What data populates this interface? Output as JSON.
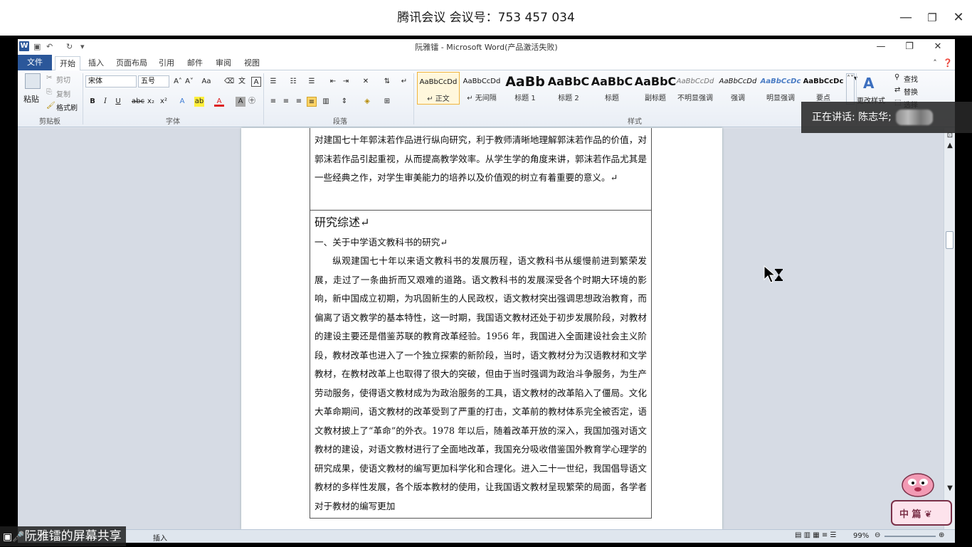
{
  "meeting": {
    "title": "腾讯会议 会议号：753 457 034",
    "minimize": "—",
    "restore": "❐",
    "close": "✕"
  },
  "word": {
    "window_title": "阮雅镭 - Microsoft Word(产品激活失败)",
    "tabs": [
      "文件",
      "开始",
      "插入",
      "页面布局",
      "引用",
      "邮件",
      "审阅",
      "视图"
    ],
    "clipboard": {
      "paste": "粘贴",
      "cut": "剪切",
      "copy": "复制",
      "format_painter": "格式刷",
      "label": "剪贴板"
    },
    "font": {
      "name": "宋体",
      "size": "五号",
      "label": "字体"
    },
    "paragraph": {
      "label": "段落"
    },
    "styles": {
      "label": "样式",
      "items": [
        {
          "preview": "AaBbCcDd",
          "name": "↵ 正文"
        },
        {
          "preview": "AaBbCcDd",
          "name": "↵ 无间隔"
        },
        {
          "preview": "AaBb",
          "name": "标题 1"
        },
        {
          "preview": "AaBbC",
          "name": "标题 2"
        },
        {
          "preview": "AaBbC",
          "name": "标题"
        },
        {
          "preview": "AaBbC",
          "name": "副标题"
        },
        {
          "preview": "AaBbCcDd",
          "name": "不明显强调"
        },
        {
          "preview": "AaBbCcDd",
          "name": "强调"
        },
        {
          "preview": "AaBbCcDc",
          "name": "明显强调"
        },
        {
          "preview": "AaBbCcDc",
          "name": "要点"
        }
      ],
      "change_styles": "更改样式"
    },
    "editing": {
      "find": "查找",
      "replace": "替换",
      "select": "选择"
    },
    "status": {
      "mode": "插入",
      "zoom": "99%"
    }
  },
  "document": {
    "cell1_text": "对建国七十年郭沫若作品进行纵向研究，利于教师清晰地理解郭沫若作品的价值，对郭沫若作品引起重视，从而提高教学效率。从学生学的角度来讲，郭沫若作品尤其是一些经典之作，对学生审美能力的培养以及价值观的树立有着重要的意义。↵",
    "heading": "研究综述↵",
    "subheading": "一、关于中学语文教科书的研究↵",
    "body": "纵观建国七十年以来语文教科书的发展历程，语文教科书从缓慢前进到繁荣发展，走过了一条曲折而又艰难的道路。语文教科书的发展深受各个时期大环境的影响，新中国成立初期，为巩固新生的人民政权，语文教材突出强调思想政治教育，而偏离了语文教学的基本特性，这一时期，我国语文教材还处于初步发展阶段，对教材的建设主要还是借鉴苏联的教育改革经验。1956 年，我国进入全面建设社会主义阶段，教材改革也进入了一个独立探索的新阶段，当时，语文教材分为汉语教材和文学教材，在教材改革上也取得了很大的突破，但由于当时强调为政治斗争服务，为生产劳动服务，使得语文教材成为为政治服务的工具，语文教材的改革陷入了僵局。文化大革命期间，语文教材的改革受到了严重的打击，文革前的教材体系完全被否定，语文教材披上了“革命”的外衣。1978 年以后，随着改革开放的深入，我国加强对语文教材的建设，对语文教材进行了全面地改革，我国充分吸收借鉴国外教育学心理学的研究成果，使语文教材的编写更加科学化和合理化。进入二十一世纪，我国倡导语文教材的多样性发展，各个版本教材的使用，让我国语文教材呈现繁荣的局面，各学者对于教材的编写更加"
  },
  "overlay": {
    "speaking": "正在讲话: 陈志华;",
    "share": "阮雅镭的屏幕共享",
    "sticker_text": "中 篇 ❦"
  }
}
